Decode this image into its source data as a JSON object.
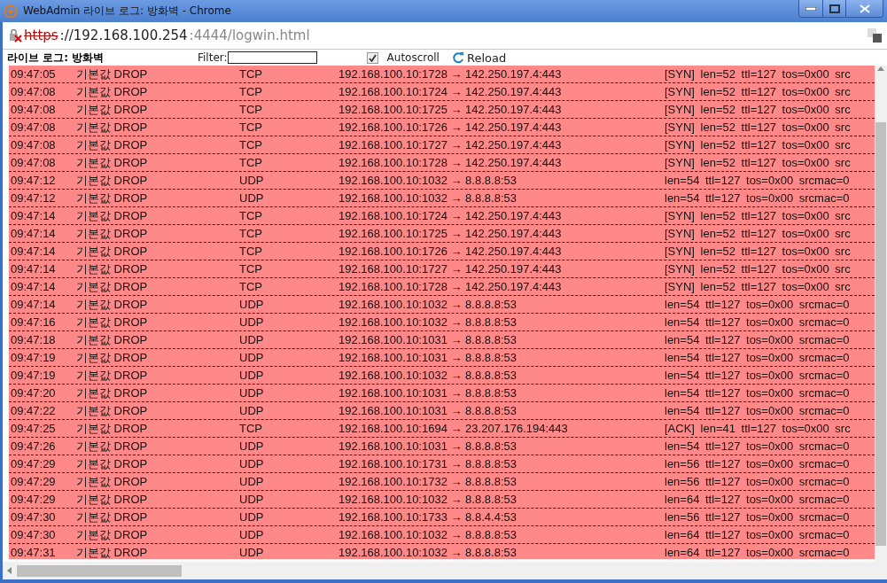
{
  "window": {
    "title": "WebAdmin 라이브 로그: 방화벽 - Chrome"
  },
  "address": {
    "scheme": "https",
    "host": "://192.168.100.254",
    "rest": ":4444/logwin.html"
  },
  "toolbar": {
    "heading": "라이브 로그: 방화벽",
    "filter_label": "Filter:",
    "autoscroll": {
      "label": "Autoscroll",
      "checked": true
    },
    "reload": "Reload"
  },
  "log_rows": [
    {
      "time": "09:47:05",
      "action": "기본값 DROP",
      "protocol": "TCP",
      "connection": "192.168.100.10:1728 → 142.250.197.4:443",
      "details": "[SYN] len=52 ttl=127 tos=0x00 src"
    },
    {
      "time": "09:47:08",
      "action": "기본값 DROP",
      "protocol": "TCP",
      "connection": "192.168.100.10:1724 → 142.250.197.4:443",
      "details": "[SYN] len=52 ttl=127 tos=0x00 src"
    },
    {
      "time": "09:47:08",
      "action": "기본값 DROP",
      "protocol": "TCP",
      "connection": "192.168.100.10:1725 → 142.250.197.4:443",
      "details": "[SYN] len=52 ttl=127 tos=0x00 src"
    },
    {
      "time": "09:47:08",
      "action": "기본값 DROP",
      "protocol": "TCP",
      "connection": "192.168.100.10:1726 → 142.250.197.4:443",
      "details": "[SYN] len=52 ttl=127 tos=0x00 src"
    },
    {
      "time": "09:47:08",
      "action": "기본값 DROP",
      "protocol": "TCP",
      "connection": "192.168.100.10:1727 → 142.250.197.4:443",
      "details": "[SYN] len=52 ttl=127 tos=0x00 src"
    },
    {
      "time": "09:47:08",
      "action": "기본값 DROP",
      "protocol": "TCP",
      "connection": "192.168.100.10:1728 → 142.250.197.4:443",
      "details": "[SYN] len=52 ttl=127 tos=0x00 src"
    },
    {
      "time": "09:47:12",
      "action": "기본값 DROP",
      "protocol": "UDP",
      "connection": "192.168.100.10:1032 → 8.8.8.8:53",
      "details": "len=54 ttl=127 tos=0x00 srcmac=0"
    },
    {
      "time": "09:47:12",
      "action": "기본값 DROP",
      "protocol": "UDP",
      "connection": "192.168.100.10:1032 → 8.8.8.8:53",
      "details": "len=54 ttl=127 tos=0x00 srcmac=0"
    },
    {
      "time": "09:47:14",
      "action": "기본값 DROP",
      "protocol": "TCP",
      "connection": "192.168.100.10:1724 → 142.250.197.4:443",
      "details": "[SYN] len=52 ttl=127 tos=0x00 src"
    },
    {
      "time": "09:47:14",
      "action": "기본값 DROP",
      "protocol": "TCP",
      "connection": "192.168.100.10:1725 → 142.250.197.4:443",
      "details": "[SYN] len=52 ttl=127 tos=0x00 src"
    },
    {
      "time": "09:47:14",
      "action": "기본값 DROP",
      "protocol": "TCP",
      "connection": "192.168.100.10:1726 → 142.250.197.4:443",
      "details": "[SYN] len=52 ttl=127 tos=0x00 src"
    },
    {
      "time": "09:47:14",
      "action": "기본값 DROP",
      "protocol": "TCP",
      "connection": "192.168.100.10:1727 → 142.250.197.4:443",
      "details": "[SYN] len=52 ttl=127 tos=0x00 src"
    },
    {
      "time": "09:47:14",
      "action": "기본값 DROP",
      "protocol": "TCP",
      "connection": "192.168.100.10:1728 → 142.250.197.4:443",
      "details": "[SYN] len=52 ttl=127 tos=0x00 src"
    },
    {
      "time": "09:47:14",
      "action": "기본값 DROP",
      "protocol": "UDP",
      "connection": "192.168.100.10:1032 → 8.8.8.8:53",
      "details": "len=54 ttl=127 tos=0x00 srcmac=0"
    },
    {
      "time": "09:47:16",
      "action": "기본값 DROP",
      "protocol": "UDP",
      "connection": "192.168.100.10:1032 → 8.8.8.8:53",
      "details": "len=54 ttl=127 tos=0x00 srcmac=0"
    },
    {
      "time": "09:47:18",
      "action": "기본값 DROP",
      "protocol": "UDP",
      "connection": "192.168.100.10:1031 → 8.8.8.8:53",
      "details": "len=54 ttl=127 tos=0x00 srcmac=0"
    },
    {
      "time": "09:47:19",
      "action": "기본값 DROP",
      "protocol": "UDP",
      "connection": "192.168.100.10:1031 → 8.8.8.8:53",
      "details": "len=54 ttl=127 tos=0x00 srcmac=0"
    },
    {
      "time": "09:47:19",
      "action": "기본값 DROP",
      "protocol": "UDP",
      "connection": "192.168.100.10:1032 → 8.8.8.8:53",
      "details": "len=54 ttl=127 tos=0x00 srcmac=0"
    },
    {
      "time": "09:47:20",
      "action": "기본값 DROP",
      "protocol": "UDP",
      "connection": "192.168.100.10:1031 → 8.8.8.8:53",
      "details": "len=54 ttl=127 tos=0x00 srcmac=0"
    },
    {
      "time": "09:47:22",
      "action": "기본값 DROP",
      "protocol": "UDP",
      "connection": "192.168.100.10:1031 → 8.8.8.8:53",
      "details": "len=54 ttl=127 tos=0x00 srcmac=0"
    },
    {
      "time": "09:47:25",
      "action": "기본값 DROP",
      "protocol": "TCP",
      "connection": "192.168.100.10:1694 → 23.207.176.194:443",
      "details": "[ACK] len=41 ttl=127 tos=0x00 src"
    },
    {
      "time": "09:47:26",
      "action": "기본값 DROP",
      "protocol": "UDP",
      "connection": "192.168.100.10:1031 → 8.8.8.8:53",
      "details": "len=54 ttl=127 tos=0x00 srcmac=0"
    },
    {
      "time": "09:47:29",
      "action": "기본값 DROP",
      "protocol": "UDP",
      "connection": "192.168.100.10:1731 → 8.8.8.8:53",
      "details": "len=56 ttl=127 tos=0x00 srcmac=0"
    },
    {
      "time": "09:47:29",
      "action": "기본값 DROP",
      "protocol": "UDP",
      "connection": "192.168.100.10:1732 → 8.8.8.8:53",
      "details": "len=56 ttl=127 tos=0x00 srcmac=0"
    },
    {
      "time": "09:47:29",
      "action": "기본값 DROP",
      "protocol": "UDP",
      "connection": "192.168.100.10:1032 → 8.8.8.8:53",
      "details": "len=64 ttl=127 tos=0x00 srcmac=0"
    },
    {
      "time": "09:47:30",
      "action": "기본값 DROP",
      "protocol": "UDP",
      "connection": "192.168.100.10:1733 → 8.8.4.4:53",
      "details": "len=56 ttl=127 tos=0x00 srcmac=0"
    },
    {
      "time": "09:47:30",
      "action": "기본값 DROP",
      "protocol": "UDP",
      "connection": "192.168.100.10:1032 → 8.8.8.8:53",
      "details": "len=64 ttl=127 tos=0x00 srcmac=0"
    },
    {
      "time": "09:47:31",
      "action": "기본값 DROP",
      "protocol": "UDP",
      "connection": "192.168.100.10:1032 → 8.8.8.8:53",
      "details": "len=64 ttl=127 tos=0x00 srcmac=0"
    }
  ]
}
